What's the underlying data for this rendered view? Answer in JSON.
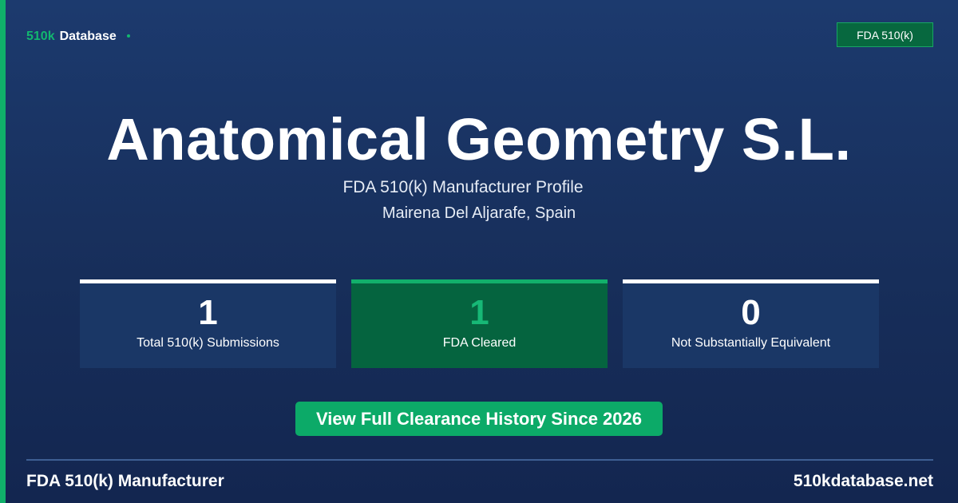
{
  "brand": {
    "part1": "510k",
    "part2": "Database"
  },
  "header_badge": "FDA 510(k)",
  "hero": {
    "title": "Anatomical Geometry S.L.",
    "subtitle": "FDA 510(k) Manufacturer Profile",
    "location": "Mairena Del Aljarafe, Spain"
  },
  "stats": [
    {
      "value": "1",
      "label": "Total 510(k) Submissions"
    },
    {
      "value": "1",
      "label": "FDA Cleared"
    },
    {
      "value": "0",
      "label": "Not Substantially Equivalent"
    }
  ],
  "cta_label": "View Full Clearance History Since 2026",
  "footer": {
    "left": "FDA 510(k) Manufacturer",
    "right": "510kdatabase.net"
  },
  "colors": {
    "accent": "#10b06a",
    "background": "#1c3a6e",
    "cleared_card": "#05643f"
  }
}
